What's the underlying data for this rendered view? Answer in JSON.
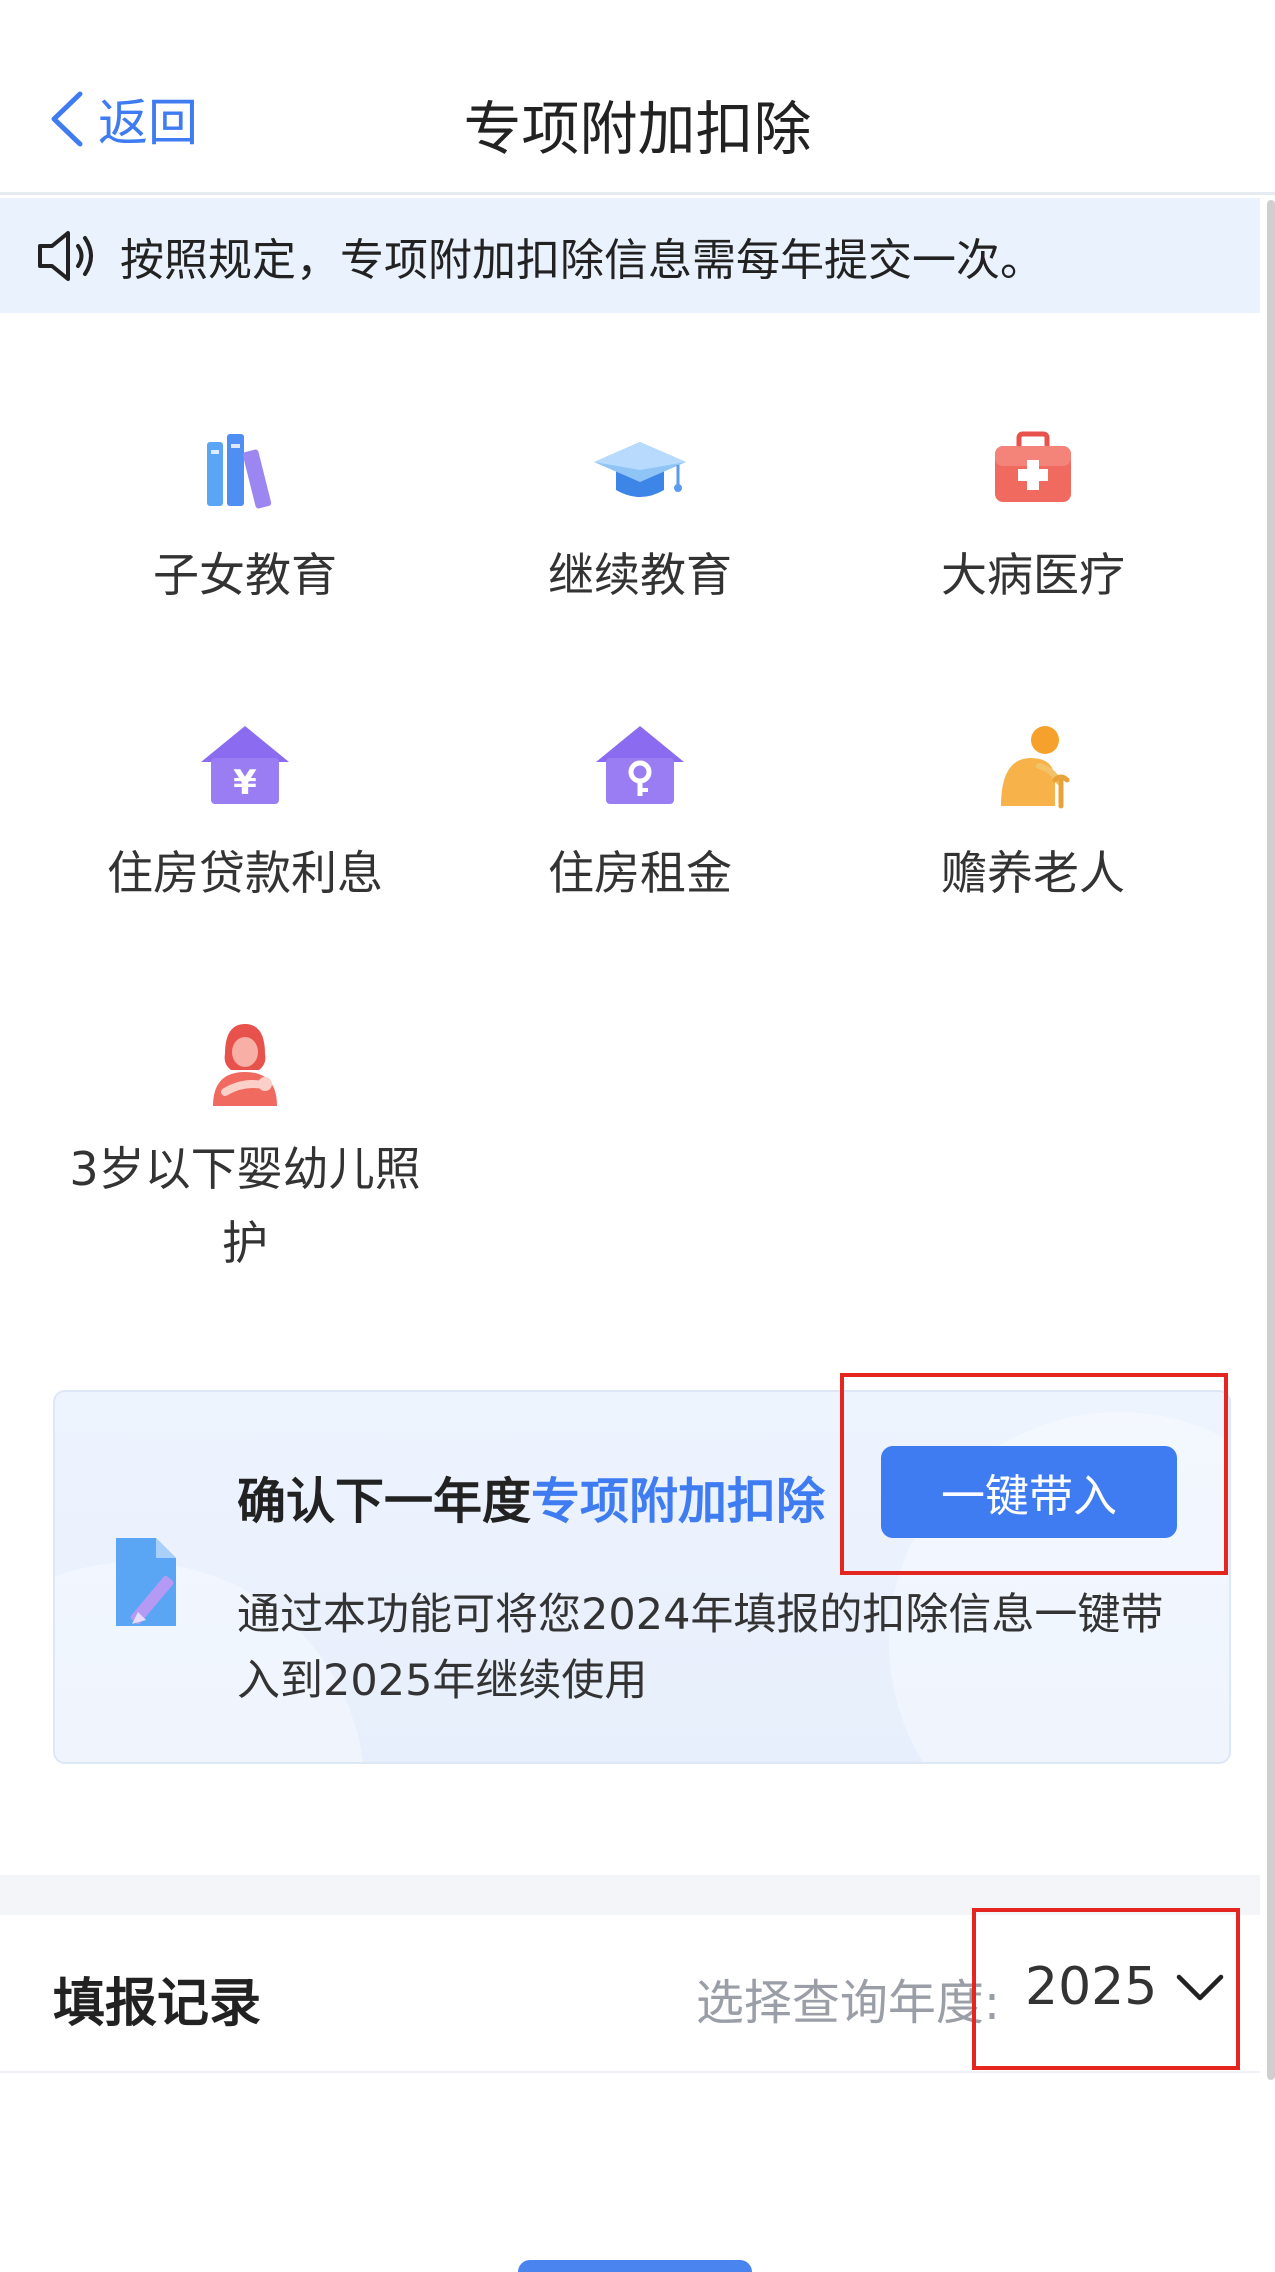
{
  "nav": {
    "back_label": "返回",
    "title": "专项附加扣除"
  },
  "notice": {
    "text": "按照规定，专项附加扣除信息需每年提交一次。"
  },
  "categories": [
    {
      "label": "子女教育",
      "icon": "books-icon"
    },
    {
      "label": "继续教育",
      "icon": "graduation-cap-icon"
    },
    {
      "label": "大病医疗",
      "icon": "medical-kit-icon"
    },
    {
      "label": "住房贷款利息",
      "icon": "house-yuan-icon"
    },
    {
      "label": "住房租金",
      "icon": "house-key-icon"
    },
    {
      "label": "赡养老人",
      "icon": "elderly-person-icon"
    },
    {
      "label": "3岁以下婴幼儿照护",
      "icon": "mother-baby-icon"
    }
  ],
  "carry_card": {
    "title_prefix": "确认下一年度",
    "title_highlight": "专项附加扣除",
    "description": "通过本功能可将您2024年填报的扣除信息一键带入到2025年继续使用",
    "button_label": "一键带入"
  },
  "records": {
    "title": "填报记录",
    "year_label": "选择查询年度:",
    "year_value": "2025"
  },
  "colors": {
    "accent": "#3f7cf2",
    "highlight_box": "#e5251f",
    "notice_bg": "#eaf2fd"
  }
}
